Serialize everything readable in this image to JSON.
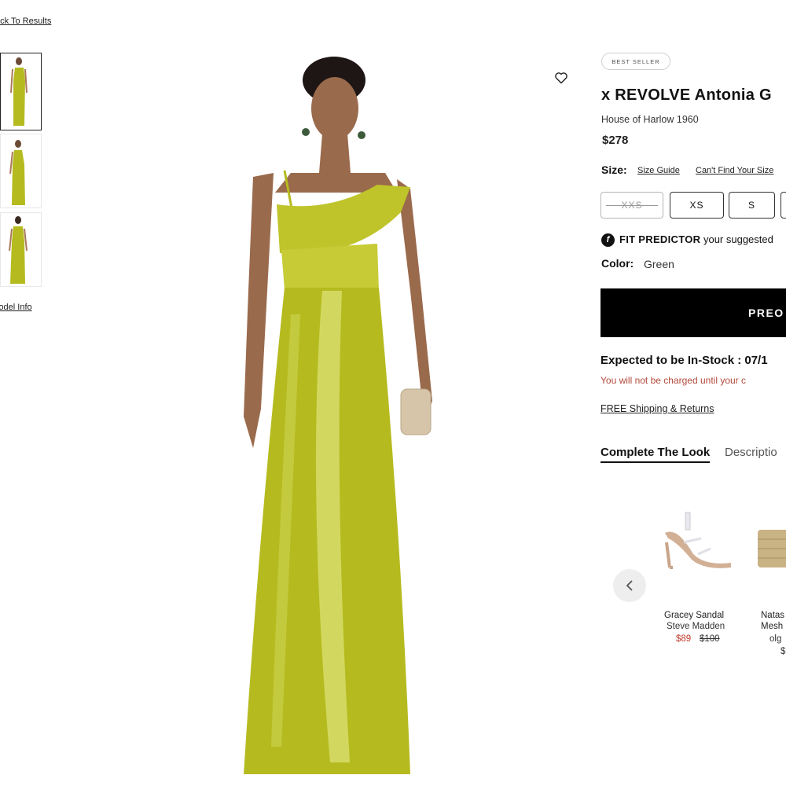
{
  "nav": {
    "back_label": "ack To Results"
  },
  "gallery": {
    "model_info_label": "lodel Info",
    "thumbnail_count": 3
  },
  "product": {
    "badge": "BEST SELLER",
    "title": "x REVOLVE Antonia G",
    "brand": "House of Harlow 1960",
    "price": "$278",
    "size_label": "Size:",
    "size_guide": "Size Guide",
    "cant_find_size": "Can't Find Your Size",
    "sizes": [
      {
        "label": "XXS",
        "available": false
      },
      {
        "label": "XS",
        "available": true
      },
      {
        "label": "S",
        "available": true
      }
    ],
    "fit_predictor_icon": "f",
    "fit_predictor_title": "FIT PREDICTOR",
    "fit_predictor_text": "your suggested",
    "color_label": "Color:",
    "color_value": "Green",
    "preorder_label": "PREO",
    "expected_stock": "Expected to be In-Stock : 07/1",
    "charge_note": "You will not be charged until your c",
    "shipping": "FREE Shipping & Returns"
  },
  "tabs": [
    {
      "label": "Complete The Look"
    },
    {
      "label": "Descriptio"
    }
  ],
  "complete_look": {
    "items": [
      {
        "name": "Gracey Sandal",
        "brand": "Steve Madden",
        "sale_price": "$89",
        "original_price": "$100"
      },
      {
        "line1": "Natas",
        "line2": "Mesh",
        "line3": "olg",
        "line4": "$"
      }
    ]
  },
  "colors": {
    "dress": "#b5bb1e",
    "sale": "#c0392b",
    "button": "#000000"
  },
  "icons": {
    "wishlist": "heart-icon",
    "carousel_prev": "chevron-left-icon",
    "fit": "fit-predictor-icon"
  }
}
